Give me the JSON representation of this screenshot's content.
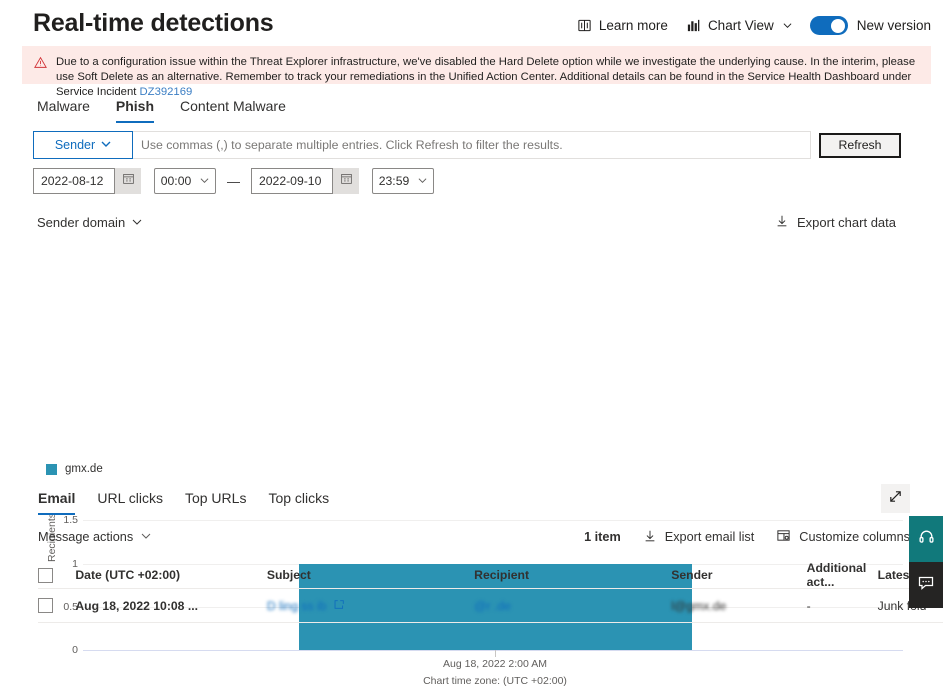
{
  "header": {
    "title": "Real-time detections",
    "learn_more": "Learn more",
    "chart_view": "Chart View",
    "new_version": "New version",
    "toggle_on": true,
    "accent_color": "#0f6cbd"
  },
  "banner": {
    "text": "Due to a configuration issue within the Threat Explorer infrastructure, we've disabled the Hard Delete option while we investigate the underlying cause. In the interim, please use Soft Delete as an alternative. Remember to track your remediations in the Unified Action Center. Additional details can be found in the Service Health Dashboard under Service Incident ",
    "link": "DZ392169",
    "background_color": "#fdeae7"
  },
  "tabs": [
    {
      "label": "Malware",
      "active": false
    },
    {
      "label": "Phish",
      "active": true
    },
    {
      "label": "Content Malware",
      "active": false
    }
  ],
  "filters": {
    "sender_label": "Sender",
    "query_value": "",
    "query_placeholder": "Use commas (,) to separate multiple entries. Click Refresh to filter the results.",
    "refresh_label": "Refresh",
    "start_date": "2022-08-12",
    "start_time": "00:00",
    "range_dash": "—",
    "end_date": "2022-09-10",
    "end_time": "23:59"
  },
  "chart_controls": {
    "group_by": "Sender domain",
    "export_chart_data": "Export chart data"
  },
  "chart_data": {
    "type": "bar",
    "title": "",
    "xlabel": "",
    "ylabel": "Recipients",
    "categories": [
      "Aug 18, 2022 2:00 AM"
    ],
    "series": [
      {
        "name": "gmx.de",
        "values": [
          1
        ],
        "color": "#2b93b3"
      }
    ],
    "ylim": [
      0,
      1.5
    ],
    "yticks": [
      "0",
      "0.5",
      "1",
      "1.5"
    ],
    "ytick_values": [
      0,
      0.5,
      1,
      1.5
    ],
    "grid": true,
    "legend_position": "bottom-left",
    "timezone_note": "Chart time zone: (UTC +02:00)"
  },
  "bottom_tabs": [
    {
      "label": "Email",
      "active": true
    },
    {
      "label": "URL clicks",
      "active": false
    },
    {
      "label": "Top URLs",
      "active": false
    },
    {
      "label": "Top clicks",
      "active": false
    }
  ],
  "table_toolbar": {
    "message_actions": "Message actions",
    "item_count": "1 item",
    "export_email_list": "Export email list",
    "customize_columns": "Customize columns"
  },
  "table": {
    "columns": [
      "Date (UTC +02:00)",
      "Subject",
      "Recipient",
      "Sender",
      "Additional act...",
      "Latest de"
    ],
    "rows": [
      {
        "date": "Aug 18, 2022 10:08 ...",
        "subject": "D                 ling               ss     ib",
        "recipient": "                @r                      .de",
        "sender": "          l@gmx.de",
        "additional_action": "-",
        "latest_delivery": "Junk fold"
      }
    ]
  },
  "fabs": {
    "support": "support-headset",
    "feedback": "feedback-chat"
  }
}
